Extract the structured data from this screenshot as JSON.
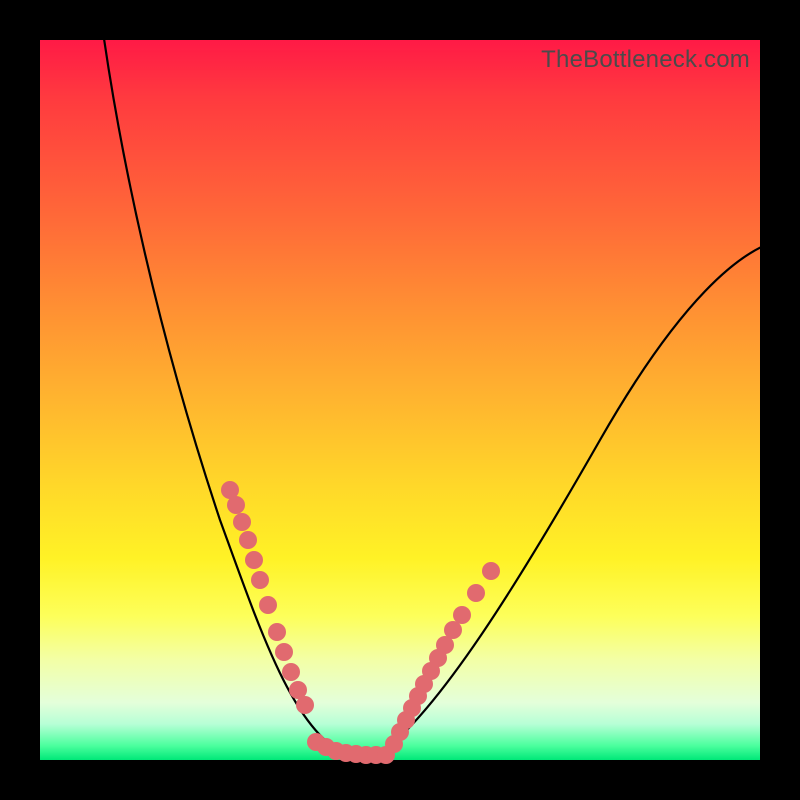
{
  "watermark": "TheBottleneck.com",
  "colors": {
    "background": "#000000",
    "gradient_top": "#ff1a46",
    "gradient_bottom": "#00e878",
    "curve": "#000000",
    "dot": "#e16a6f"
  },
  "chart_data": {
    "type": "line",
    "title": "",
    "xlabel": "",
    "ylabel": "",
    "xlim": [
      0,
      100
    ],
    "ylim": [
      0,
      100
    ],
    "series": [
      {
        "name": "bottleneck-curve",
        "x": [
          0,
          3,
          6,
          9,
          12,
          15,
          18,
          21,
          24,
          27,
          30,
          33,
          35,
          37,
          39,
          41,
          43,
          46,
          50,
          55,
          60,
          65,
          70,
          75,
          80,
          85,
          90,
          95,
          100
        ],
        "y": [
          100,
          91,
          82,
          73,
          65,
          57,
          49,
          41,
          34,
          27,
          21,
          15,
          11,
          7,
          4,
          2,
          1,
          1,
          4,
          9,
          15,
          22,
          29,
          36,
          43,
          50,
          56,
          62,
          67
        ]
      }
    ],
    "markers": {
      "left_branch": [
        {
          "x": 22,
          "y": 37
        },
        {
          "x": 22.7,
          "y": 35
        },
        {
          "x": 23.5,
          "y": 33
        },
        {
          "x": 24.3,
          "y": 31
        },
        {
          "x": 25,
          "y": 28
        },
        {
          "x": 25.7,
          "y": 26
        },
        {
          "x": 27,
          "y": 22
        },
        {
          "x": 28.3,
          "y": 18
        },
        {
          "x": 29.3,
          "y": 15
        },
        {
          "x": 30.5,
          "y": 12
        },
        {
          "x": 31.5,
          "y": 10
        },
        {
          "x": 33,
          "y": 7
        }
      ],
      "trough": [
        {
          "x": 34,
          "y": 2.8
        },
        {
          "x": 35.5,
          "y": 2.1
        },
        {
          "x": 37,
          "y": 1.6
        },
        {
          "x": 38.5,
          "y": 1.3
        },
        {
          "x": 40,
          "y": 1.1
        },
        {
          "x": 41.5,
          "y": 1.0
        },
        {
          "x": 43,
          "y": 1.0
        },
        {
          "x": 44.5,
          "y": 1.0
        }
      ],
      "right_branch": [
        {
          "x": 46,
          "y": 1.5
        },
        {
          "x": 47,
          "y": 3
        },
        {
          "x": 48,
          "y": 5
        },
        {
          "x": 49,
          "y": 7
        },
        {
          "x": 50,
          "y": 9
        },
        {
          "x": 51,
          "y": 11
        },
        {
          "x": 52,
          "y": 13
        },
        {
          "x": 53,
          "y": 15
        },
        {
          "x": 54,
          "y": 17
        },
        {
          "x": 55,
          "y": 19
        },
        {
          "x": 56,
          "y": 21
        },
        {
          "x": 58,
          "y": 25
        },
        {
          "x": 60,
          "y": 28
        }
      ]
    }
  }
}
